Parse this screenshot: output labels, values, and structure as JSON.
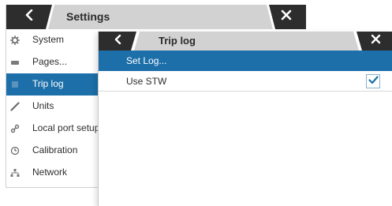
{
  "settings": {
    "title": "Settings",
    "back_icon": "chevron-left-icon",
    "close_icon": "close-icon",
    "header_color": "#2d2d2d",
    "menu": [
      {
        "label": "System",
        "icon": "gear-icon",
        "active": false
      },
      {
        "label": "Pages...",
        "icon": "pages-icon",
        "active": false
      },
      {
        "label": "Trip log",
        "icon": "trip-log-icon",
        "active": true
      },
      {
        "label": "Units",
        "icon": "ruler-icon",
        "active": false
      },
      {
        "label": "Local port setup",
        "icon": "port-link-icon",
        "active": false
      },
      {
        "label": "Calibration",
        "icon": "calibration-icon",
        "active": false
      },
      {
        "label": "Network",
        "icon": "network-icon",
        "active": false
      }
    ]
  },
  "triplog": {
    "title": "Trip log",
    "back_icon": "chevron-left-icon",
    "close_icon": "close-icon",
    "selection_color": "#1c6fa9",
    "items": [
      {
        "label": "Set Log...",
        "selected": true,
        "checkbox": false
      },
      {
        "label": "Use STW",
        "selected": false,
        "checkbox": true,
        "checked": true
      }
    ]
  }
}
